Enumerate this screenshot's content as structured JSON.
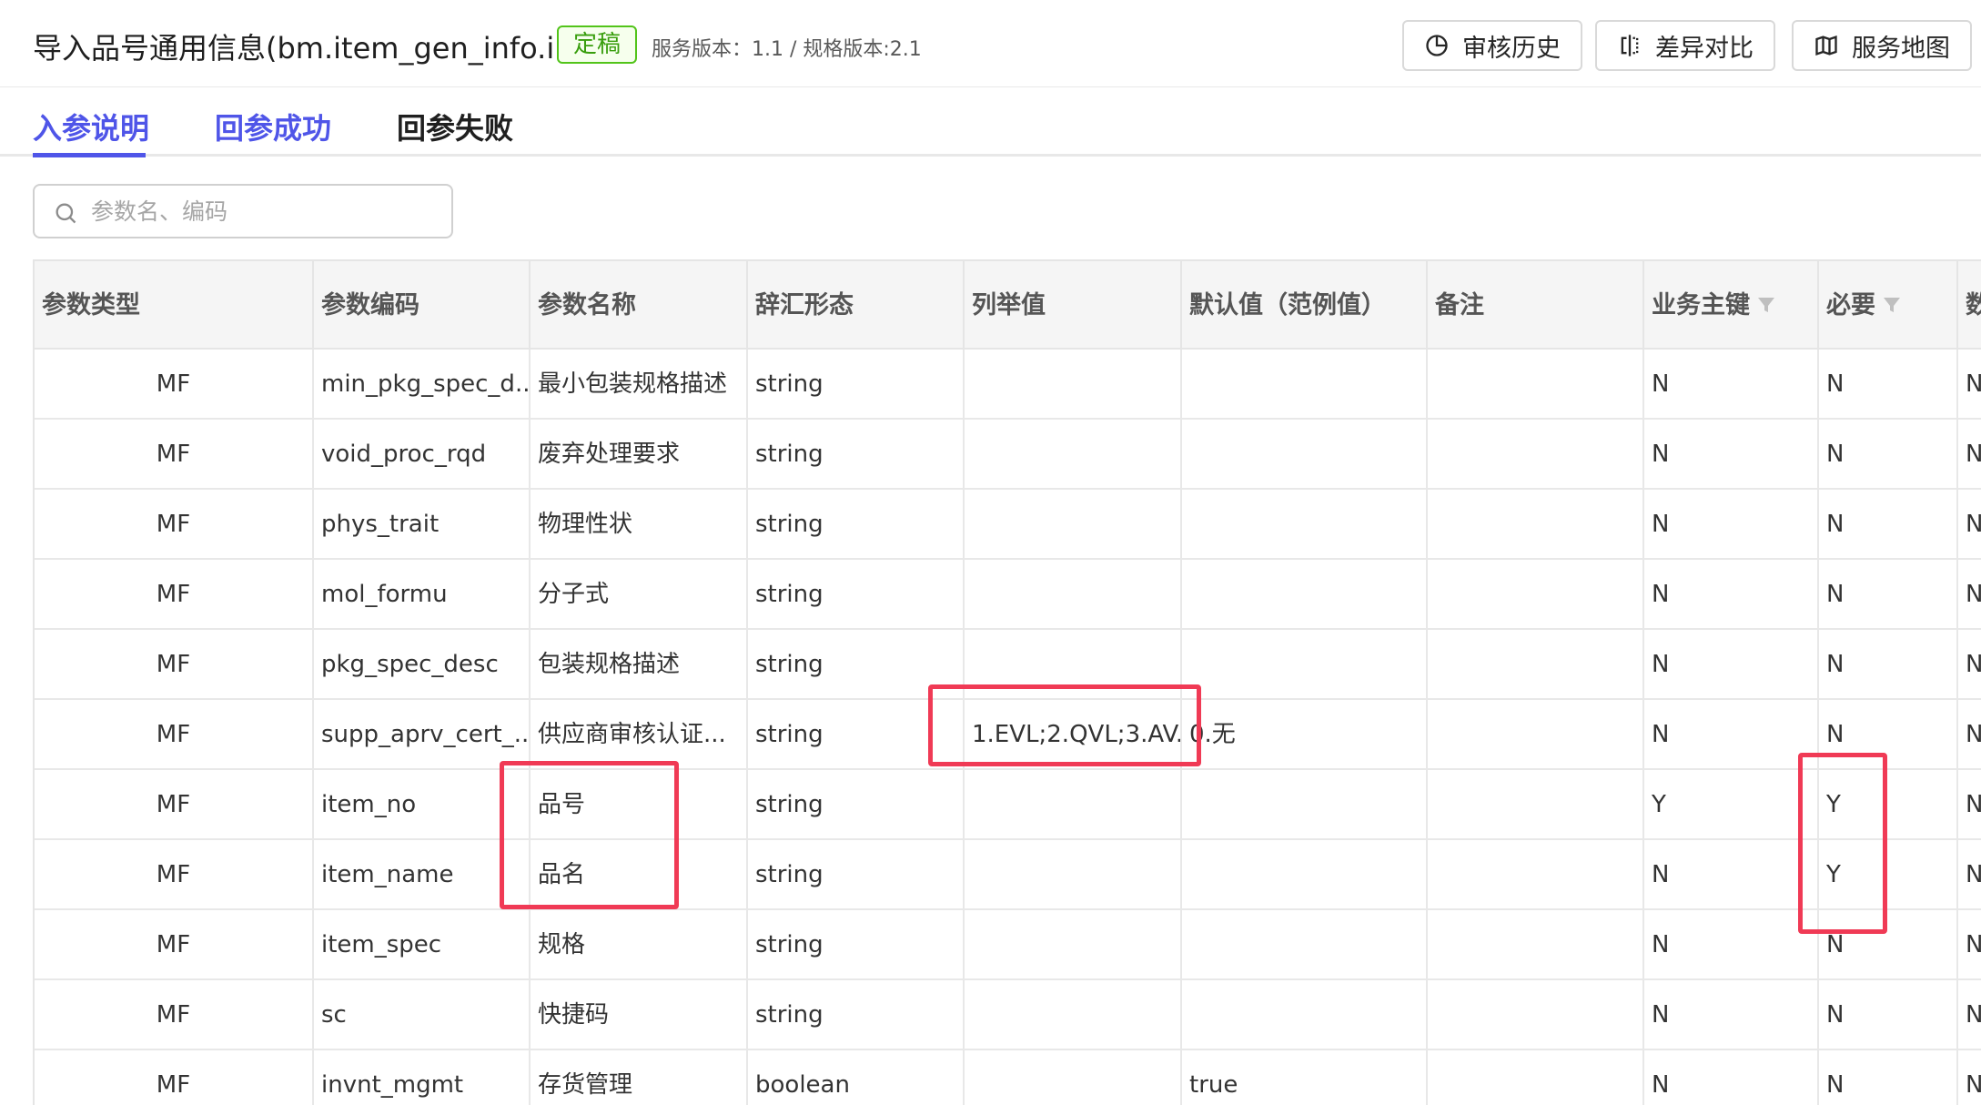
{
  "header": {
    "title": "导入品号通用信息(bm.item_gen_info.i...",
    "badge": "定稿",
    "version": "服务版本：1.1 / 规格版本:2.1",
    "buttons": [
      {
        "label": "审核历史",
        "icon": "history-pie-icon"
      },
      {
        "label": "差异对比",
        "icon": "compare-icon"
      },
      {
        "label": "服务地图",
        "icon": "map-icon"
      }
    ]
  },
  "tabs": [
    {
      "label": "入参说明",
      "active": true
    },
    {
      "label": "回参成功",
      "active": false
    },
    {
      "label": "回参失败",
      "active": false
    }
  ],
  "search": {
    "placeholder": "参数名、编码",
    "value": ""
  },
  "table": {
    "columns": [
      "参数类型",
      "参数编码",
      "参数名称",
      "辞汇形态",
      "列举值",
      "默认值（范例值）",
      "备注",
      "业务主键",
      "必要",
      "数"
    ],
    "rows": [
      [
        "MF",
        "min_pkg_spec_d...",
        "最小包装规格描述",
        "string",
        "",
        "",
        "",
        "N",
        "N",
        "N"
      ],
      [
        "MF",
        "void_proc_rqd",
        "废弃处理要求",
        "string",
        "",
        "",
        "",
        "N",
        "N",
        "N"
      ],
      [
        "MF",
        "phys_trait",
        "物理性状",
        "string",
        "",
        "",
        "",
        "N",
        "N",
        "N"
      ],
      [
        "MF",
        "mol_formu",
        "分子式",
        "string",
        "",
        "",
        "",
        "N",
        "N",
        "N"
      ],
      [
        "MF",
        "pkg_spec_desc",
        "包装规格描述",
        "string",
        "",
        "",
        "",
        "N",
        "N",
        "N"
      ],
      [
        "MF",
        "supp_aprv_cert_...",
        "供应商审核认证...",
        "string",
        "1.EVL;2.QVL;3.AV...",
        "0.无",
        "",
        "N",
        "N",
        "N"
      ],
      [
        "MF",
        "item_no",
        "品号",
        "string",
        "",
        "",
        "",
        "Y",
        "Y",
        "N"
      ],
      [
        "MF",
        "item_name",
        "品名",
        "string",
        "",
        "",
        "",
        "N",
        "Y",
        "N"
      ],
      [
        "MF",
        "item_spec",
        "规格",
        "string",
        "",
        "",
        "",
        "N",
        "N",
        "N"
      ],
      [
        "MF",
        "sc",
        "快捷码",
        "string",
        "",
        "",
        "",
        "N",
        "N",
        "N"
      ],
      [
        "MF",
        "invnt_mgmt",
        "存货管理",
        "boolean",
        "",
        "true",
        "",
        "N",
        "N",
        "N"
      ]
    ]
  },
  "colors": {
    "accent": "#4f55e8",
    "highlight": "#f03a55",
    "badge": "#52c41a"
  }
}
